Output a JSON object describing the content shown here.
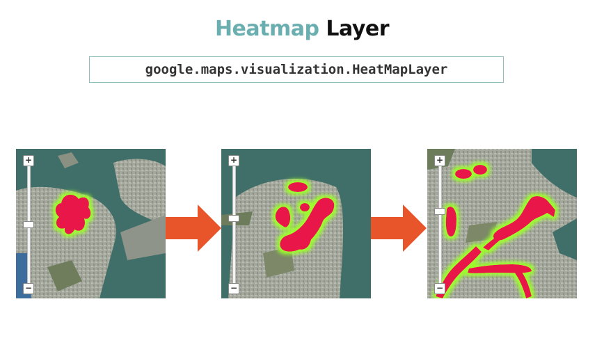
{
  "title": {
    "highlight": "Heatmap",
    "rest": "Layer"
  },
  "code": "google.maps.visualization.HeatMapLayer",
  "maps": [
    {
      "zoom_in": "+",
      "zoom_out": "−"
    },
    {
      "zoom_in": "+",
      "zoom_out": "−"
    },
    {
      "zoom_in": "+",
      "zoom_out": "−"
    }
  ],
  "colors": {
    "title_accent": "#6aaeb0",
    "arrow": "#e8552a",
    "heat_core": "#e8184a",
    "heat_edge": "#8cff2a",
    "water": "#3f6f68",
    "land": "#9a9f93"
  }
}
